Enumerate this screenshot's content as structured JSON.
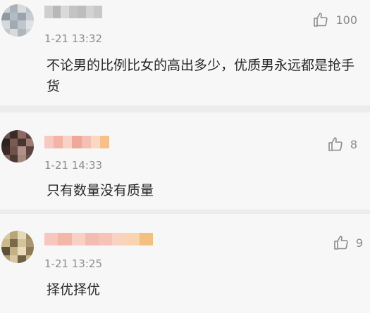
{
  "comments": [
    {
      "time": "1-21 13:32",
      "likes": "100",
      "text": "不论男的比例比女的高出多少，优质男永远都是抢手货",
      "avatar_colors": [
        "#c9cfd4",
        "#a9b2ba",
        "#d8dcdf",
        "#bcc5cb",
        "#8f9ba4",
        "#b4bcc3",
        "#9aa4ad",
        "#c6ccd2",
        "#d5d9dc",
        "#a1abb3",
        "#bfc6cc",
        "#e0e3e5",
        "#c0c7cd",
        "#d7dbde",
        "#aeb7be",
        "#cfd4d8"
      ],
      "name_colors": [
        "#cfcfcf",
        "#b8b8b8",
        "#d9d9d9",
        "#c4c4c4",
        "#bdbdbd",
        "#d3d3d3",
        "#c8c8c8"
      ]
    },
    {
      "time": "1-21 14:33",
      "likes": "8",
      "text": "只有数量没有质量",
      "avatar_colors": [
        "#6b4f4a",
        "#3c2a28",
        "#8a6a62",
        "#5a403c",
        "#2e2220",
        "#7a5a52",
        "#4a3430",
        "#9c7c70",
        "#3a2826",
        "#6e524a",
        "#b0928a",
        "#5c423e",
        "#82665e",
        "#4e3834",
        "#a4887e",
        "#6a4e48"
      ],
      "name_colors": [
        "#f7c9c1",
        "#f3b3a7",
        "#f9d2c6",
        "#f0a999",
        "#f5bfb3",
        "#fbd8c0",
        "#f7c08a"
      ]
    },
    {
      "time": "1-21 13:25",
      "likes": "9",
      "text": "择优择优",
      "avatar_colors": [
        "#d9c9a0",
        "#b8a57a",
        "#e6d9b6",
        "#9e8c62",
        "#cbb98c",
        "#7a6a48",
        "#d4c49a",
        "#a89670",
        "#5e503a",
        "#c2b088",
        "#e8dcbc",
        "#8c7a56",
        "#b09e76",
        "#d6c8a2",
        "#6e6044",
        "#c8b88e"
      ],
      "name_colors": [
        "#f7c7bd",
        "#f3b7a9",
        "#f8d0c4",
        "#f2bcb0",
        "#f6c3b6",
        "#f9d2c2",
        "#f8d4b0",
        "#f3c080"
      ]
    }
  ]
}
